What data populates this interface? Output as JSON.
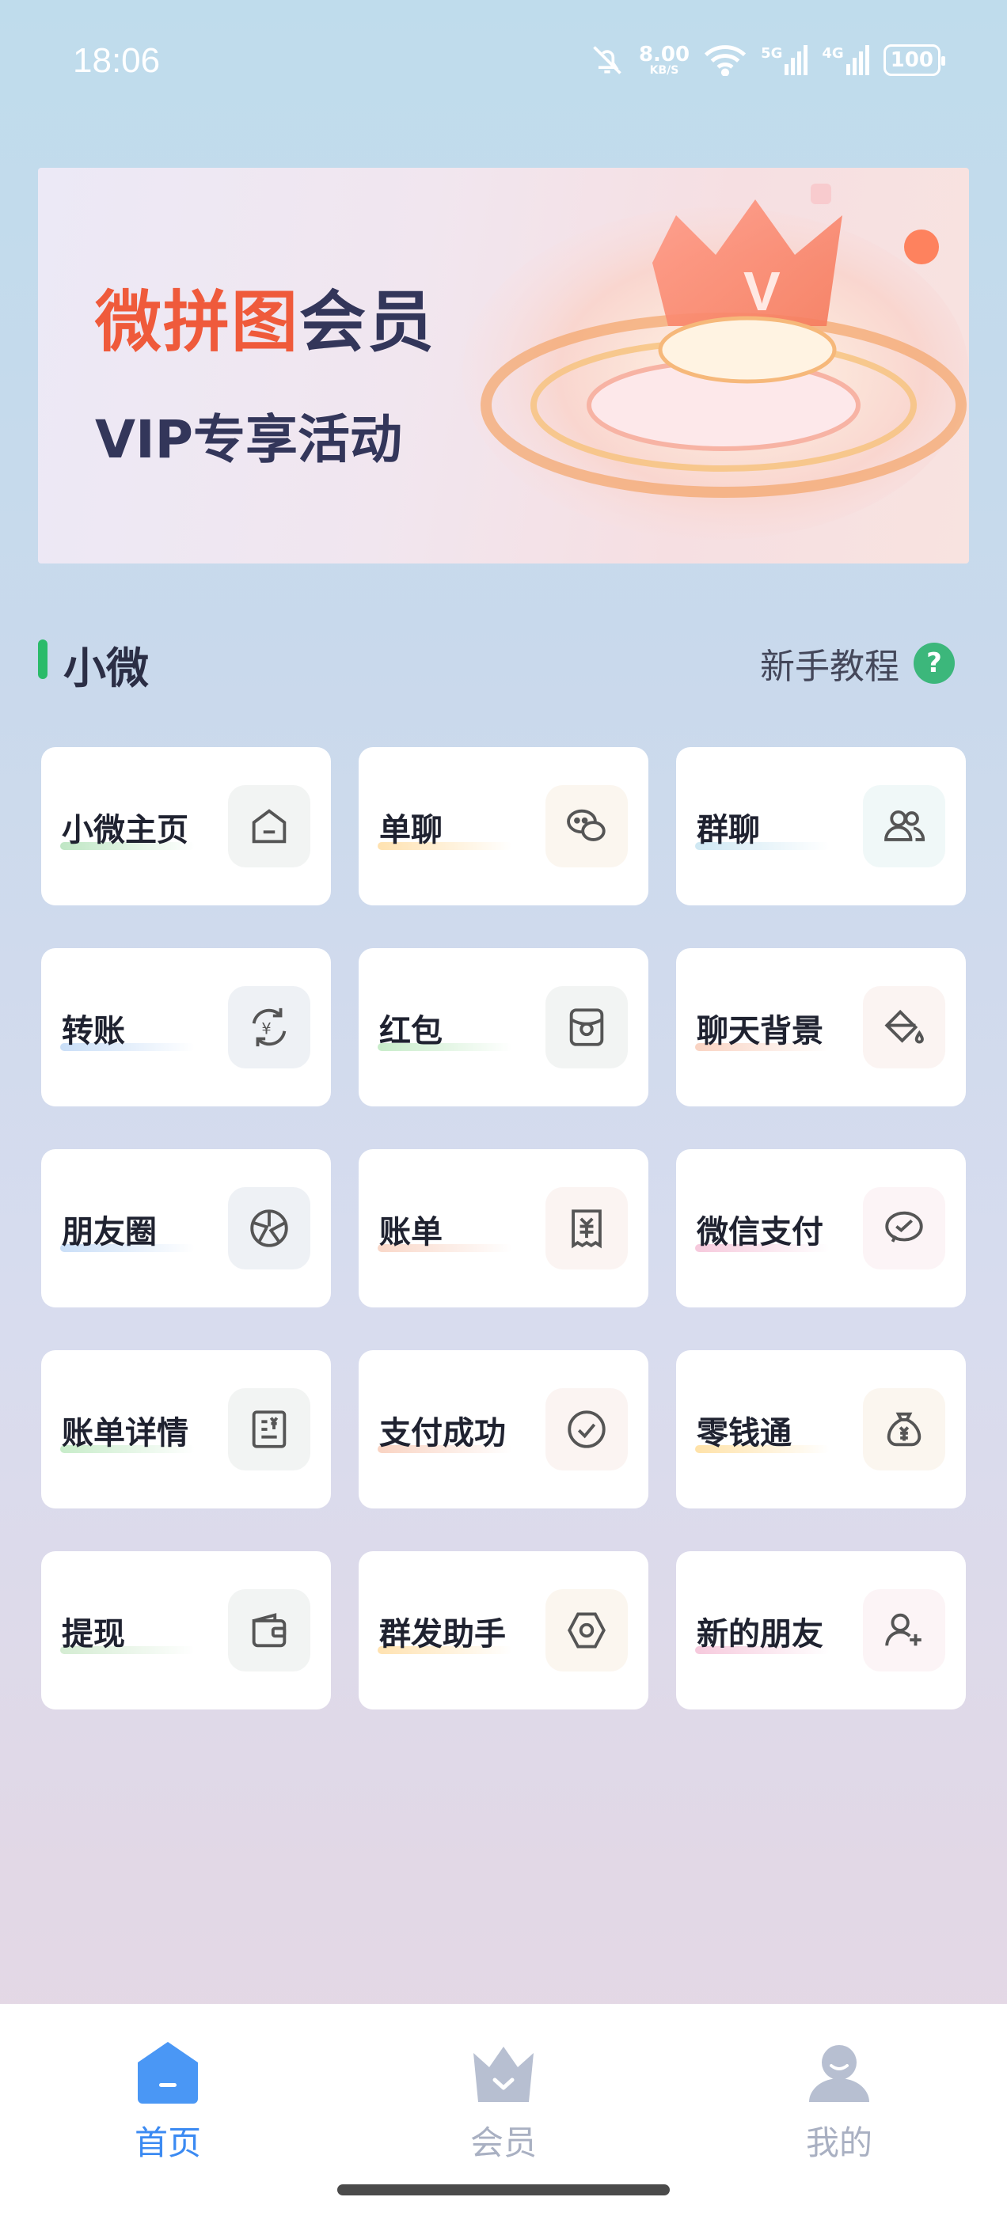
{
  "status_bar": {
    "time": "18:06",
    "net_speed_value": "8.00",
    "net_speed_unit": "KB/S",
    "net_1": "5G",
    "net_2": "4G",
    "battery": "100"
  },
  "banner": {
    "title_highlight": "微拼图",
    "title_rest": "会员",
    "subtitle": "VIP专享活动",
    "brand_color": "#ef5a3b"
  },
  "section": {
    "title": "小微",
    "tutorial_label": "新手教程",
    "help_icon_text": "?"
  },
  "tools": [
    {
      "label": "小微主页",
      "icon": "home-icon",
      "underline": "#bfe6c4",
      "icon_bg": "#f2f4f3"
    },
    {
      "label": "单聊",
      "icon": "chat-icon",
      "underline": "#ffe2b0",
      "icon_bg": "#fbf6ef"
    },
    {
      "label": "群聊",
      "icon": "group-icon",
      "underline": "#cfe8f3",
      "icon_bg": "#f0f8f8"
    },
    {
      "label": "转账",
      "icon": "transfer-icon",
      "underline": "#c9def7",
      "icon_bg": "#eef1f5"
    },
    {
      "label": "红包",
      "icon": "red-packet-icon",
      "underline": "#c7ecc9",
      "icon_bg": "#f2f4f3"
    },
    {
      "label": "聊天背景",
      "icon": "paint-bucket-icon",
      "underline": "#f9d3c2",
      "icon_bg": "#fbf4f2"
    },
    {
      "label": "朋友圈",
      "icon": "moments-icon",
      "underline": "#c9def7",
      "icon_bg": "#eef1f5"
    },
    {
      "label": "账单",
      "icon": "receipt-icon",
      "underline": "#f9d7c8",
      "icon_bg": "#fbf4f2"
    },
    {
      "label": "微信支付",
      "icon": "pay-icon",
      "underline": "#f6c9dc",
      "icon_bg": "#fcf4f6"
    },
    {
      "label": "账单详情",
      "icon": "bill-detail-icon",
      "underline": "#c7ecc9",
      "icon_bg": "#f2f4f3"
    },
    {
      "label": "支付成功",
      "icon": "check-circle-icon",
      "underline": "#f9d3c2",
      "icon_bg": "#fbf4f2"
    },
    {
      "label": "零钱通",
      "icon": "money-bag-icon",
      "underline": "#ffe2a8",
      "icon_bg": "#fbf6ef"
    },
    {
      "label": "提现",
      "icon": "wallet-icon",
      "underline": "#d4ecd2",
      "icon_bg": "#f2f4f3"
    },
    {
      "label": "群发助手",
      "icon": "hexagon-icon",
      "underline": "#ffe2b0",
      "icon_bg": "#fbf6ef"
    },
    {
      "label": "新的朋友",
      "icon": "add-friend-icon",
      "underline": "#f6c9dc",
      "icon_bg": "#fcf4f6"
    }
  ],
  "bottom_nav": {
    "home": "首页",
    "vip": "会员",
    "mine": "我的",
    "active_color": "#3b8af2",
    "inactive_color": "#a9b0c2"
  }
}
